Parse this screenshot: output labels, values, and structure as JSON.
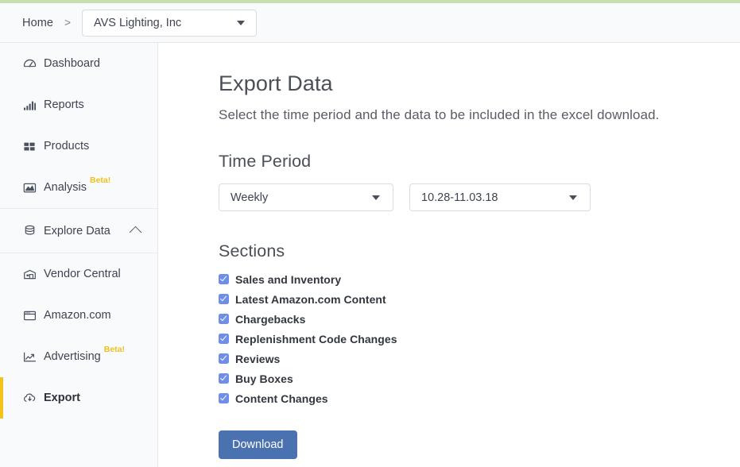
{
  "theme": {
    "accent_strip": "#c5e0ae",
    "active_marker": "#f3c319",
    "beta_badge": "#f0bf1e",
    "checkbox_fill": "#6f8ee8",
    "primary_button": "#4a72b0",
    "sidebar_bg": "#f9fafb",
    "topbar_bg": "#f9fafb"
  },
  "topbar": {
    "home_label": "Home",
    "separator": ">",
    "org_select": {
      "value": "AVS Lighting, Inc",
      "caret_icon": "chevron-down-icon"
    }
  },
  "sidebar": {
    "items": [
      {
        "label": "Dashboard",
        "icon": "speedometer-icon",
        "active": false
      },
      {
        "label": "Reports",
        "icon": "bar-chart-icon",
        "active": false
      },
      {
        "label": "Products",
        "icon": "grid-squares-icon",
        "active": false
      },
      {
        "label": "Analysis",
        "icon": "area-chart-icon",
        "active": false,
        "badge": "Beta!"
      }
    ],
    "group": {
      "label": "Explore Data",
      "icon": "database-icon",
      "expanded": true,
      "chevron_icon": "chevron-up-icon"
    },
    "sub_items": [
      {
        "label": "Vendor Central",
        "icon": "warehouse-icon",
        "active": false
      },
      {
        "label": "Amazon.com",
        "icon": "browser-window-icon",
        "active": false
      },
      {
        "label": "Advertising",
        "icon": "trending-up-chart-icon",
        "active": false,
        "badge": "Beta!"
      },
      {
        "label": "Export",
        "icon": "cloud-download-icon",
        "active": true
      }
    ]
  },
  "main": {
    "title": "Export Data",
    "subtitle": "Select the time period and the data to be included in the excel download.",
    "time_period": {
      "heading": "Time Period",
      "granularity": {
        "value": "Weekly",
        "caret_icon": "chevron-down-icon"
      },
      "date_range": {
        "value": "10.28-11.03.18",
        "caret_icon": "chevron-down-icon"
      }
    },
    "sections": {
      "heading": "Sections",
      "items": [
        {
          "label": "Sales and Inventory",
          "checked": true
        },
        {
          "label": "Latest Amazon.com Content",
          "checked": true
        },
        {
          "label": "Chargebacks",
          "checked": true
        },
        {
          "label": "Replenishment Code Changes",
          "checked": true
        },
        {
          "label": "Reviews",
          "checked": true
        },
        {
          "label": "Buy Boxes",
          "checked": true
        },
        {
          "label": "Content Changes",
          "checked": true
        }
      ]
    },
    "download_label": "Download"
  }
}
